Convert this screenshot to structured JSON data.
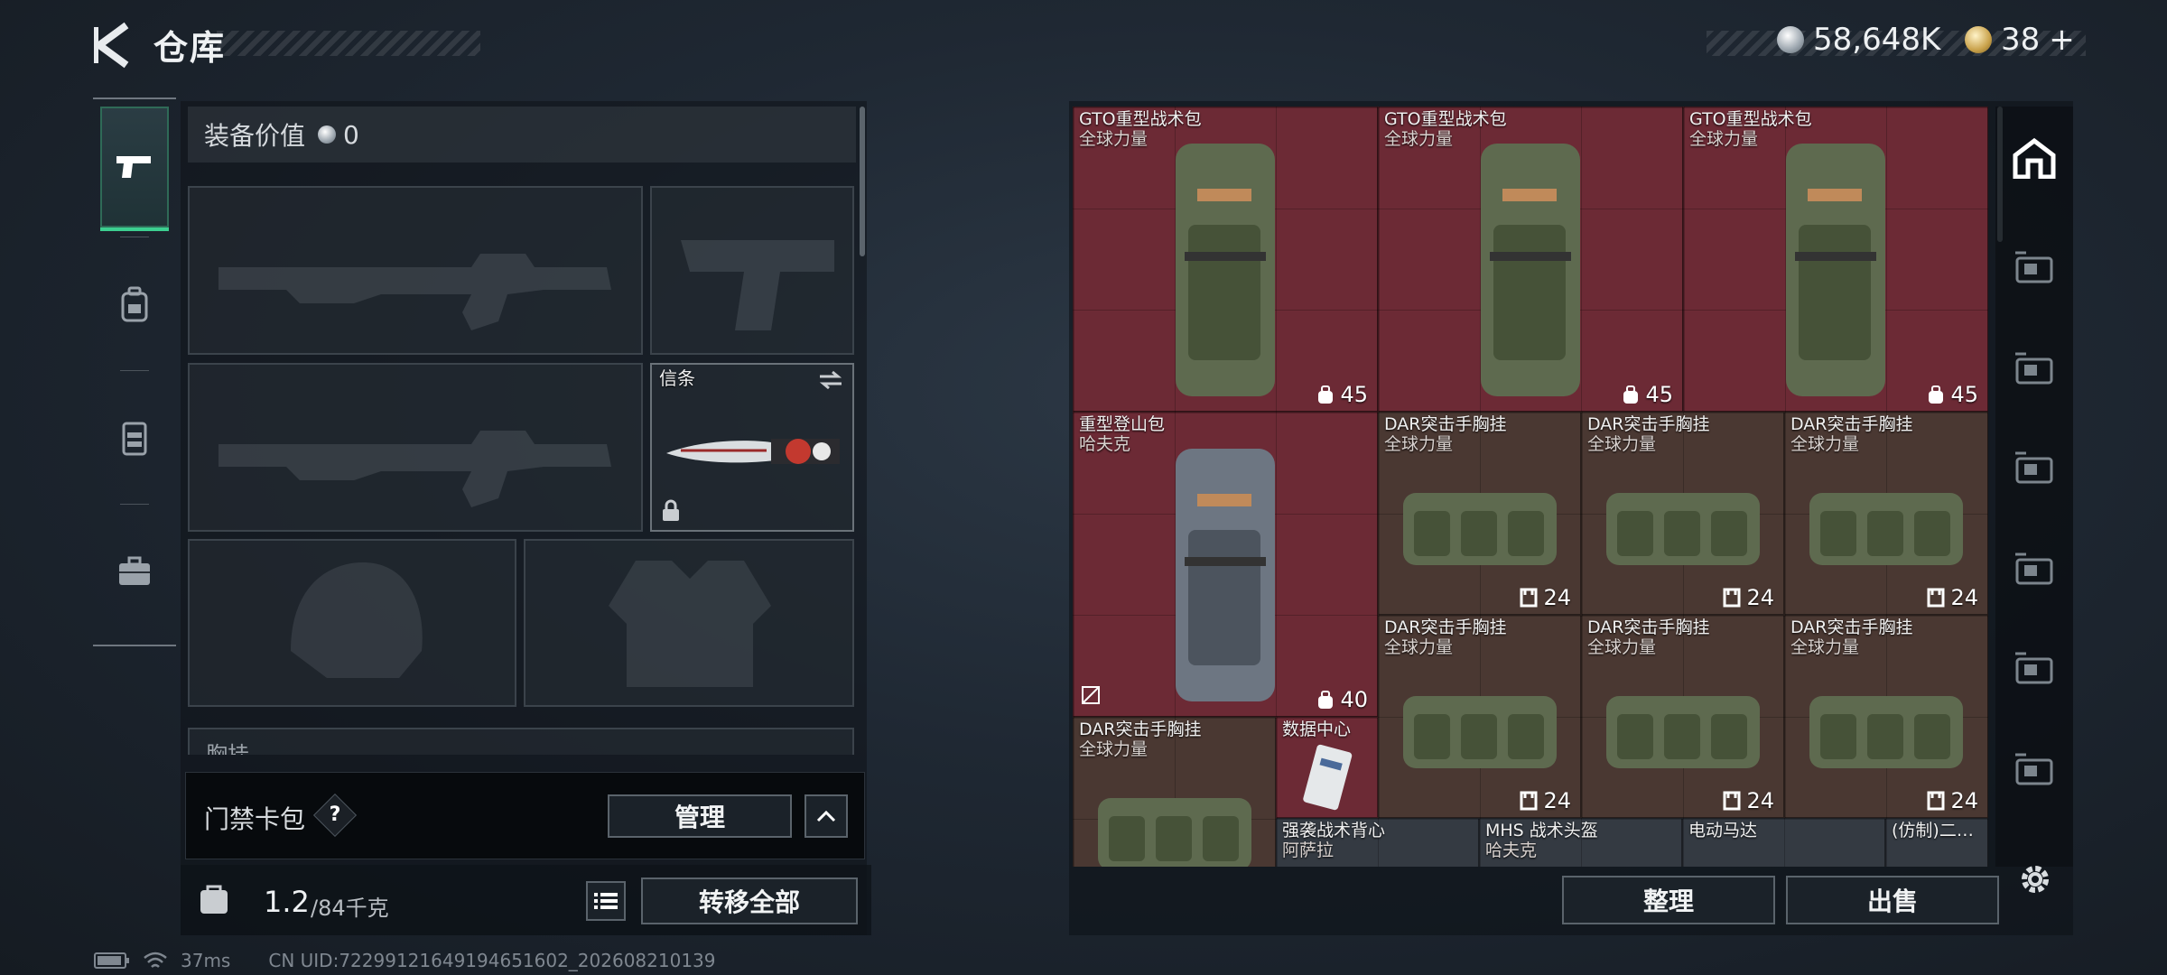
{
  "header": {
    "title": "仓库",
    "silver_amount": "58,648K",
    "gold_amount": "38",
    "gold_plus": "+"
  },
  "left_tabs": [
    "weapon-tab",
    "backpack-tab",
    "vest-tab",
    "case-tab"
  ],
  "equipment": {
    "value_label": "装备价值",
    "value": "0",
    "melee_label": "信条",
    "chest_rig_label": "胸挂"
  },
  "keycard": {
    "label": "门禁卡包",
    "help": "?",
    "manage_button": "管理"
  },
  "capacity": {
    "current": "1.2",
    "max": "/84千克"
  },
  "transfer_all_button": "转移全部",
  "status": {
    "ping": "37ms",
    "uid": "CN UID:72299121649194651602_202608210139"
  },
  "items": [
    {
      "name1": "GTO重型战术包",
      "name2": "全球力量",
      "cap": "45"
    },
    {
      "name1": "GTO重型战术包",
      "name2": "全球力量",
      "cap": "45"
    },
    {
      "name1": "GTO重型战术包",
      "name2": "全球力量",
      "cap": "45"
    },
    {
      "name1": "重型登山包",
      "name2": "哈夫克",
      "cap": "40"
    },
    {
      "name1": "DAR突击手胸挂",
      "name2": "全球力量",
      "cap": "24"
    },
    {
      "name1": "DAR突击手胸挂",
      "name2": "全球力量",
      "cap": "24"
    },
    {
      "name1": "DAR突击手胸挂",
      "name2": "全球力量",
      "cap": "24"
    },
    {
      "name1": "DAR突击手胸挂",
      "name2": "全球力量",
      "cap": "24"
    },
    {
      "name1": "DAR突击手胸挂",
      "name2": "全球力量",
      "cap": "24"
    },
    {
      "name1": "DAR突击手胸挂",
      "name2": "全球力量",
      "cap": "24"
    },
    {
      "name1": "DAR突击手胸挂",
      "name2": "全球力量",
      "cap": ""
    },
    {
      "name1": "数据中心",
      "name2": "",
      "cap": ""
    },
    {
      "name1": "强袭战术背心",
      "name2": "阿萨拉",
      "cap": ""
    },
    {
      "name1": "MHS 战术头盔",
      "name2": "哈夫克",
      "cap": ""
    },
    {
      "name1": "电动马达",
      "name2": "",
      "cap": ""
    },
    {
      "name1": "(仿制)二…",
      "name2": "",
      "cap": ""
    }
  ],
  "right_nav": [
    "vault-icon",
    "tier-v-armor-icon",
    "tier-iv-armor-icon",
    "tier-iv-folder-icon",
    "tier-iii-rig-icon",
    "tier-iii-warning-icon",
    "tier-iv-add-icon"
  ],
  "actions": {
    "sort_button": "整理",
    "sell_button": "出售"
  },
  "colors": {
    "accent_green": "#3ccf90",
    "rarity_red": "#6c2a35",
    "rarity_brown": "#4a3832"
  }
}
